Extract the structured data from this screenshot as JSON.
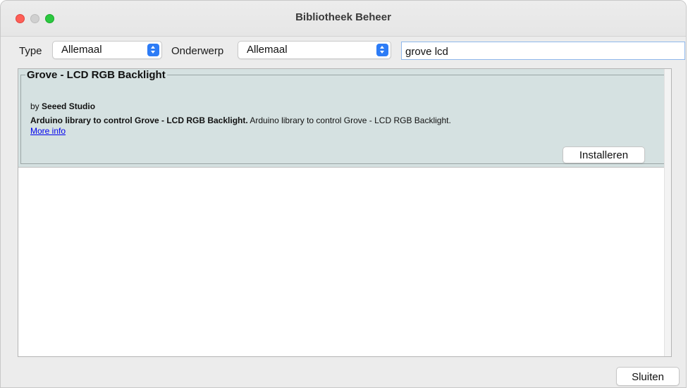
{
  "window": {
    "title": "Bibliotheek Beheer"
  },
  "filters": {
    "type_label": "Type",
    "type_value": "Allemaal",
    "topic_label": "Onderwerp",
    "topic_value": "Allemaal"
  },
  "search": {
    "value": "grove lcd"
  },
  "library": {
    "name": "Grove - LCD RGB Backlight",
    "by_prefix": "by",
    "author": "Seeed Studio",
    "summary": "Arduino library to control Grove - LCD RGB Backlight.",
    "description": "Arduino library to control Grove - LCD RGB Backlight.",
    "more_info": "More info",
    "install_label": "Installeren"
  },
  "footer": {
    "close_label": "Sluiten"
  },
  "colors": {
    "accent": "#2d7cf6",
    "entry_background": "#d5e1e1",
    "close": "#fe5f57",
    "maximize": "#2bc840"
  }
}
